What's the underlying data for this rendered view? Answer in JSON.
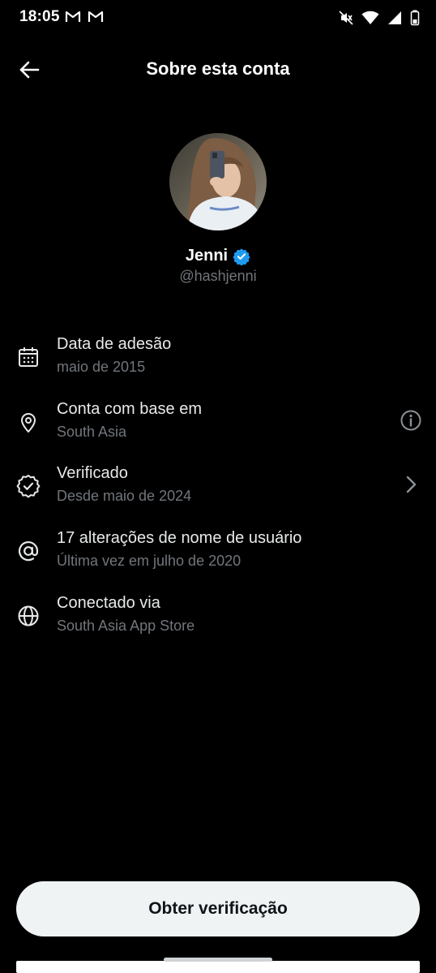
{
  "status_bar": {
    "time": "18:05",
    "notification_icons": [
      "gmail-icon",
      "gmail-icon"
    ],
    "system_icons": [
      "mute-icon",
      "wifi-icon",
      "signal-icon",
      "battery-icon"
    ]
  },
  "header": {
    "title": "Sobre esta conta",
    "back_icon": "arrow-left-icon"
  },
  "profile": {
    "name": "Jenni",
    "handle": "@hashjenni",
    "verified": true,
    "verified_color": "#1d9bf0"
  },
  "info_rows": [
    {
      "icon": "calendar-icon",
      "title": "Data de adesão",
      "subtitle": "maio de 2015"
    },
    {
      "icon": "location-pin-icon",
      "title": "Conta com base em",
      "subtitle": "South Asia",
      "right_icon": "info-icon"
    },
    {
      "icon": "verified-badge-icon",
      "title": "Verificado",
      "subtitle": "Desde maio de 2024",
      "right_icon": "chevron-right-icon"
    },
    {
      "icon": "at-sign-icon",
      "title": "17 alterações de nome de usuário",
      "subtitle": "Última vez em julho de 2020"
    },
    {
      "icon": "globe-icon",
      "title": "Conectado via",
      "subtitle": "South Asia App Store"
    }
  ],
  "cta": {
    "label": "Obter verificação"
  },
  "colors": {
    "background": "#000000",
    "primary_text": "#e7e9ea",
    "secondary_text": "#71767b",
    "button_bg": "#eff3f4",
    "button_text": "#0f1419"
  }
}
